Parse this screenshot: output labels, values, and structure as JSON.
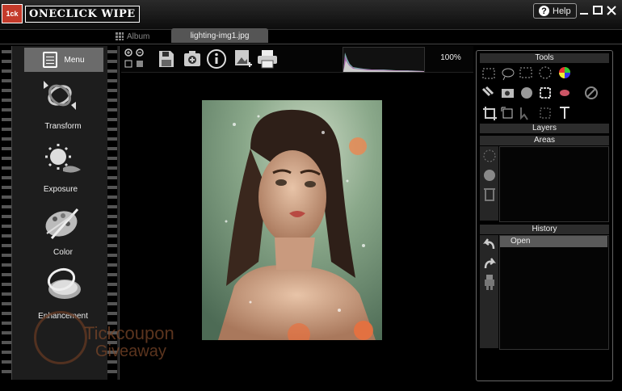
{
  "app": {
    "title": "ONECLICK WIPE",
    "help_label": "Help"
  },
  "tabs": [
    {
      "label": "Album"
    },
    {
      "label": "lighting-img1.jpg"
    }
  ],
  "left_menu": {
    "menu_label": "Menu",
    "items": [
      {
        "label": "Transform",
        "icon": "transform-icon"
      },
      {
        "label": "Exposure",
        "icon": "exposure-icon"
      },
      {
        "label": "Color",
        "icon": "color-palette-icon"
      },
      {
        "label": "Enhancement",
        "icon": "enhancement-icon"
      }
    ]
  },
  "toolbar": {
    "zoom": "100%",
    "icons": [
      "zoom-in-icon",
      "zoom-out-icon",
      "fit-icon",
      "actual-size-icon",
      "save-icon",
      "add-to-album-icon",
      "info-icon",
      "add-image-icon",
      "print-icon"
    ]
  },
  "right_panel": {
    "tools_header": "Tools",
    "layers_header": "Layers",
    "areas_header": "Areas",
    "history_header": "History",
    "history_items": [
      "Open"
    ]
  },
  "watermark": {
    "line1": "Tickcoupon",
    "line2": "Giveaway"
  },
  "colors": {
    "background": "#000000",
    "panel": "#1d1d1d",
    "selected": "#6b6b6b",
    "logo_red": "#c43a2a"
  }
}
